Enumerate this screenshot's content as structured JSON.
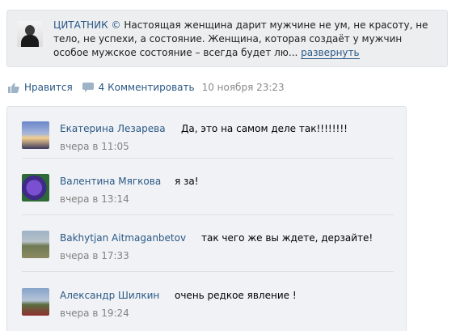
{
  "post": {
    "source": "ЦИТАТНИК ©",
    "text": " Настоящая женщина дарит мужчине не ум, не красоту, не тело, не успехи, а состояние. Женщина, которая создаёт у мужчин особое мужское состояние – всегда будет лю... ",
    "more_label": "развернуть"
  },
  "actions": {
    "like_label": "Нравится",
    "comment_label": "4 Комментировать",
    "date": "10 ноября 23:23"
  },
  "comments": [
    {
      "author": "Екатерина Лезарева",
      "text": "Да, это на самом деле так!!!!!!!!",
      "time": "вчера в 11:05"
    },
    {
      "author": "Валентина Мягкова",
      "text": "я за!",
      "time": "вчера в 13:14"
    },
    {
      "author": "Bakhytjan Aitmaganbetov",
      "text": "так чего же вы ждете, дерзайте!",
      "time": "вчера в 17:33"
    },
    {
      "author": "Александр Шилкин",
      "text": "очень редкое явление !",
      "time": "вчера в 19:24"
    }
  ],
  "colors": {
    "link": "#2a5885",
    "meta": "#828282",
    "card_bg": "#edeef0",
    "comments_bg": "#f0f2f5"
  },
  "icons": {
    "like": "thumbs-up-icon",
    "comment": "comment-bubble-icon"
  }
}
